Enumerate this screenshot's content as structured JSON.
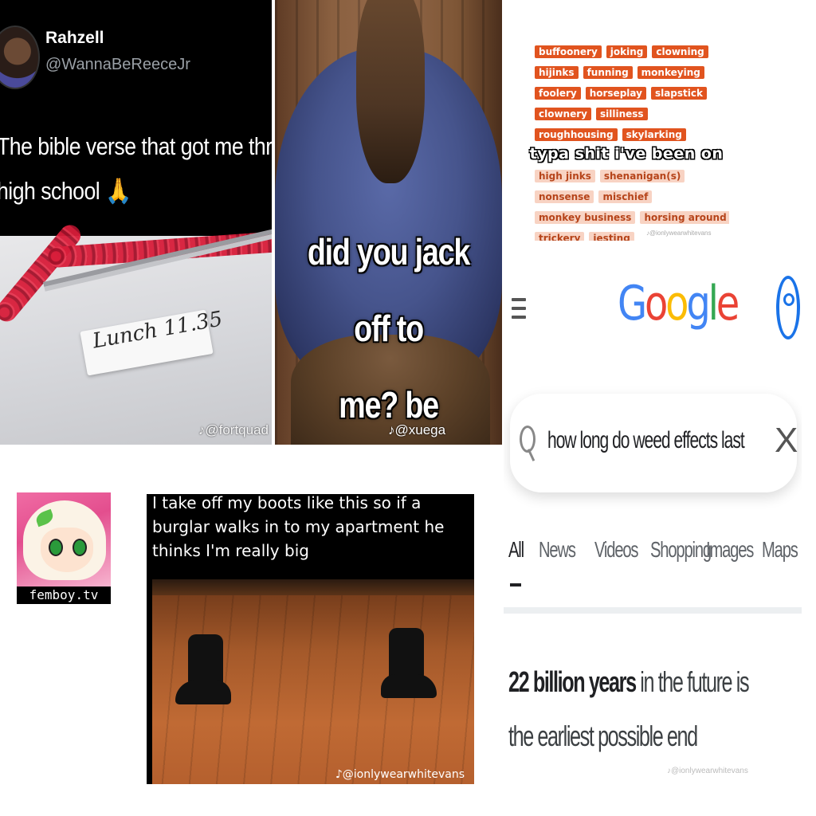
{
  "tweet": {
    "name": "Rahzell",
    "handle": "@WannaBeReeceJr",
    "text_line1": "The bible verse that got me throug",
    "text_line2": "high school 🙏",
    "sign_text": "Lunch 11.35",
    "watermark": "♪@fortquad"
  },
  "bear": {
    "caption_line1": "did you jack off to",
    "caption_line2": "me? be honest",
    "watermark": "♪@xuega"
  },
  "synonyms": {
    "rows": [
      [
        {
          "t": "buffoonery",
          "s": "dark"
        },
        {
          "t": "joking",
          "s": "dark"
        },
        {
          "t": "clowning",
          "s": "dark"
        }
      ],
      [
        {
          "t": "hijinks",
          "s": "dark"
        },
        {
          "t": "funning",
          "s": "dark"
        },
        {
          "t": "monkeying",
          "s": "dark"
        }
      ],
      [
        {
          "t": "foolery",
          "s": "dark"
        },
        {
          "t": "horseplay",
          "s": "dark"
        },
        {
          "t": "slapstick",
          "s": "dark"
        }
      ],
      [
        {
          "t": "clownery",
          "s": "dark"
        },
        {
          "t": "silliness",
          "s": "dark"
        }
      ],
      [
        {
          "t": "roughhousing",
          "s": "dark"
        },
        {
          "t": "skylarking",
          "s": "dark"
        }
      ],
      [],
      [
        {
          "t": "high jinks",
          "s": "light"
        },
        {
          "t": "shenanigan(s)",
          "s": "light"
        }
      ],
      [
        {
          "t": "nonsense",
          "s": "light"
        },
        {
          "t": "mischief",
          "s": "light"
        }
      ],
      [
        {
          "t": "monkey business",
          "s": "light"
        },
        {
          "t": "horsing around",
          "s": "light"
        }
      ],
      [
        {
          "t": "trickery",
          "s": "light"
        },
        {
          "t": "jesting",
          "s": "light"
        }
      ]
    ],
    "overlay_text": "typa shit i've been on",
    "watermark": "♪@ionlywearwhitevans"
  },
  "google": {
    "logo_letters": [
      {
        "c": "G",
        "color": "#4285f4"
      },
      {
        "c": "o",
        "color": "#ea4335"
      },
      {
        "c": "o",
        "color": "#fbbc05"
      },
      {
        "c": "g",
        "color": "#4285f4"
      },
      {
        "c": "l",
        "color": "#34a853"
      },
      {
        "c": "e",
        "color": "#ea4335"
      }
    ],
    "query": "how long do weed effects last",
    "clear_glyph": "X",
    "tabs": [
      "All",
      "News",
      "Videos",
      "Shopping",
      "Images",
      "Maps"
    ],
    "snippet_bold": "22 billion years",
    "snippet_rest": " in the future is the earliest possible end",
    "watermark": "♪@ionlywearwhitevans"
  },
  "femboy": {
    "label": "femboy.tv"
  },
  "boots": {
    "caption": "I take off my boots like this so if a burglar walks in to my apartment he thinks I'm really big",
    "watermark": "♪@ionlywearwhitevans"
  }
}
